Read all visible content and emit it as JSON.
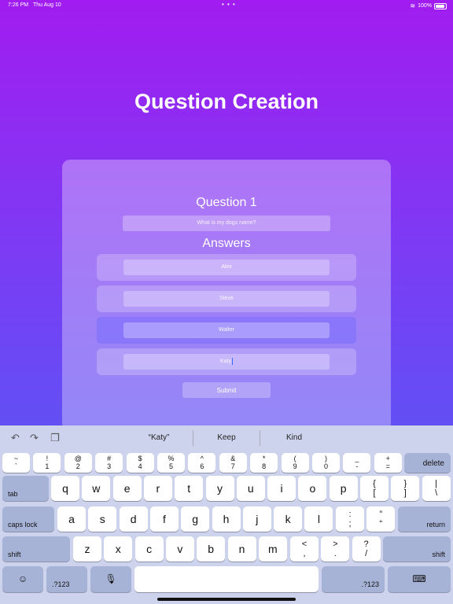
{
  "status": {
    "time": "7:26 PM",
    "date": "Thu Aug 10",
    "dots": "• • •",
    "battery": "100%"
  },
  "page": {
    "title": "Question Creation"
  },
  "question": {
    "label": "Question 1",
    "value": "What is my dogs name?"
  },
  "answers": {
    "label": "Answers",
    "items": [
      "Alex",
      "Steve",
      "Walter",
      "Katy"
    ]
  },
  "submit_label": "Submit",
  "keyboard": {
    "suggestions": [
      "“Katy”",
      "Keep",
      "Kind"
    ],
    "icons": {
      "undo": "undo-icon",
      "redo": "redo-icon",
      "paste": "clipboard-icon"
    },
    "number_row": [
      [
        "~",
        "`"
      ],
      [
        "!",
        "1"
      ],
      [
        "@",
        "2"
      ],
      [
        "#",
        "3"
      ],
      [
        "$",
        "4"
      ],
      [
        "%",
        "5"
      ],
      [
        "^",
        "6"
      ],
      [
        "&",
        "7"
      ],
      [
        "*",
        "8"
      ],
      [
        "(",
        "9"
      ],
      [
        ")",
        "0"
      ],
      [
        "_",
        "-"
      ],
      [
        "+",
        "="
      ]
    ],
    "delete_label": "delete",
    "tab_label": "tab",
    "row_q": [
      "q",
      "w",
      "e",
      "r",
      "t",
      "y",
      "u",
      "i",
      "o",
      "p"
    ],
    "row_q_sym": [
      [
        "{",
        "["
      ],
      [
        "}",
        "]"
      ],
      [
        "|",
        "\\"
      ]
    ],
    "caps_label": "caps lock",
    "row_a": [
      "a",
      "s",
      "d",
      "f",
      "g",
      "h",
      "j",
      "k",
      "l"
    ],
    "row_a_sym": [
      [
        ":",
        ";"
      ],
      [
        "”",
        "“"
      ]
    ],
    "return_label": "return",
    "shift_label": "shift",
    "row_z": [
      "z",
      "x",
      "c",
      "v",
      "b",
      "n",
      "m"
    ],
    "row_z_sym": [
      [
        "<",
        ","
      ],
      [
        ">",
        "."
      ],
      [
        "?",
        "/"
      ]
    ],
    "num_label": ".?123",
    "emoji_icon": "emoji-icon",
    "mic_icon": "microphone-icon",
    "dismiss_icon": "keyboard-dismiss-icon"
  }
}
